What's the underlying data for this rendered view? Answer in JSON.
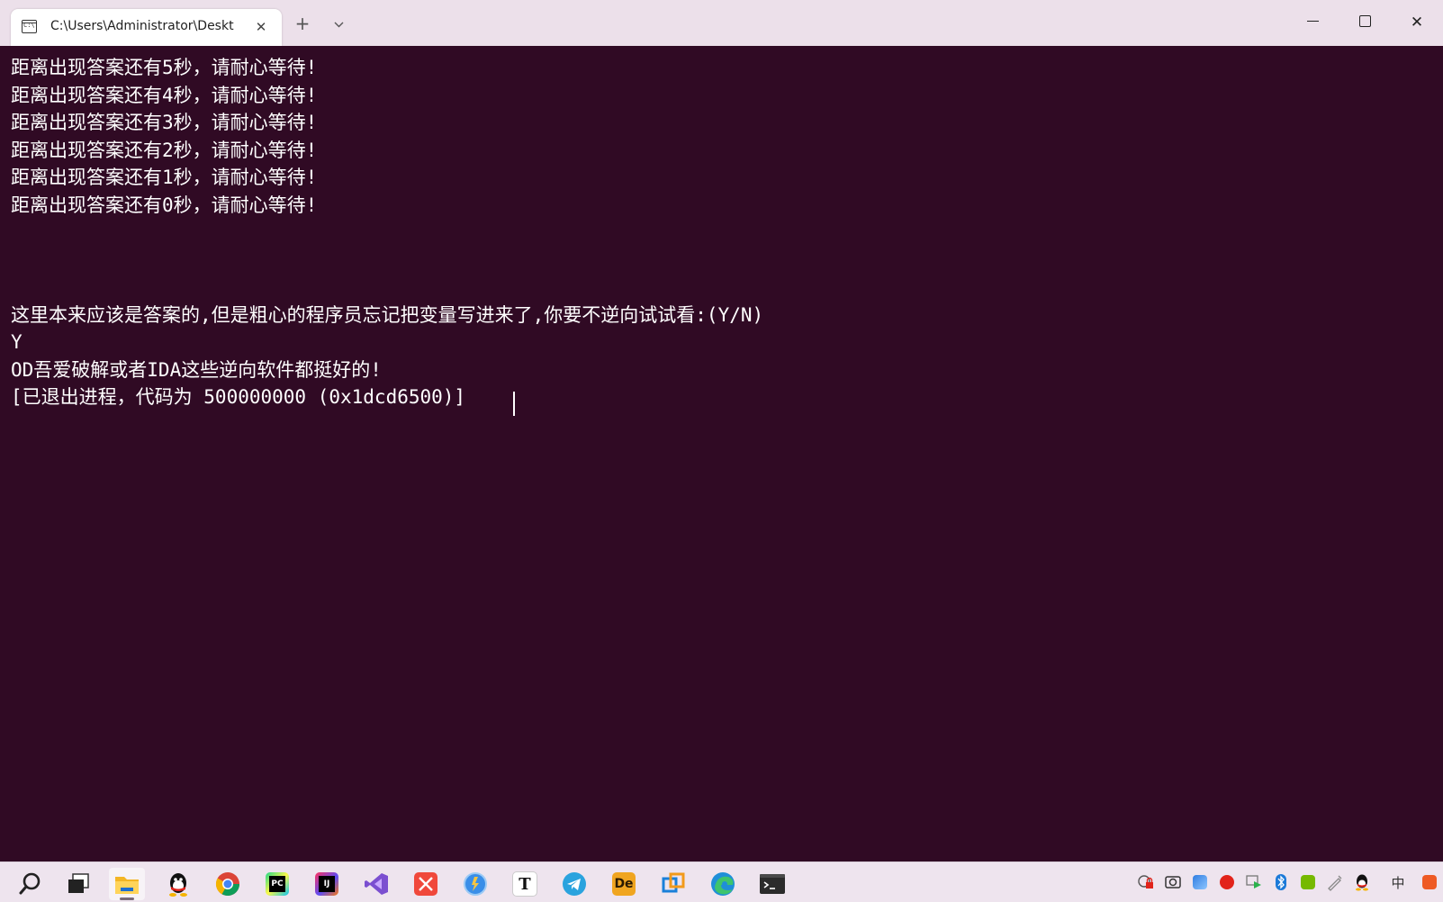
{
  "window": {
    "tab_title": "C:\\Users\\Administrator\\Deskt",
    "tab_icon_text": "C:\\",
    "tab_close": "✕",
    "new_tab": "+",
    "tab_dropdown": "⌄",
    "close_glyph": "✕"
  },
  "terminal": {
    "background": "#300a24",
    "foreground": "#ffffff",
    "lines": [
      "距离出现答案还有5秒，请耐心等待!",
      "距离出现答案还有4秒，请耐心等待!",
      "距离出现答案还有3秒，请耐心等待!",
      "距离出现答案还有2秒，请耐心等待!",
      "距离出现答案还有1秒，请耐心等待!",
      "距离出现答案还有0秒，请耐心等待!",
      "",
      "",
      "",
      "这里本来应该是答案的,但是粗心的程序员忘记把变量写进来了,你要不逆向试试看:(Y/N)",
      "Y",
      "OD吾爱破解或者IDA这些逆向软件都挺好的!",
      "[已退出进程，代码为 500000000 (0x1dcd6500)]"
    ]
  },
  "taskbar": {
    "apps": [
      {
        "icon": "search-icon",
        "label": ""
      },
      {
        "icon": "task-view-icon",
        "label": ""
      },
      {
        "icon": "file-explorer-icon",
        "label": ""
      },
      {
        "icon": "qq-icon",
        "label": ""
      },
      {
        "icon": "chrome-icon",
        "label": ""
      },
      {
        "icon": "pycharm-icon",
        "label": "PC"
      },
      {
        "icon": "intellij-icon",
        "label": "IJ"
      },
      {
        "icon": "visual-studio-icon",
        "label": ""
      },
      {
        "icon": "xmind-icon",
        "label": ""
      },
      {
        "icon": "app-blue-circle-icon",
        "label": ""
      },
      {
        "icon": "typora-icon",
        "label": "T"
      },
      {
        "icon": "telegram-icon",
        "label": ""
      },
      {
        "icon": "davinci-icon",
        "label": "De"
      },
      {
        "icon": "virtualbox-icon",
        "label": ""
      },
      {
        "icon": "edge-icon",
        "label": ""
      },
      {
        "icon": "terminal-icon",
        "label": ""
      }
    ],
    "tray": [
      {
        "icon": "security-lock-icon"
      },
      {
        "icon": "camera-icon"
      },
      {
        "icon": "image-app-icon"
      },
      {
        "icon": "audio-app-icon"
      },
      {
        "icon": "media-icon"
      },
      {
        "icon": "bluetooth-icon"
      },
      {
        "icon": "nvidia-icon"
      },
      {
        "icon": "pen-icon"
      },
      {
        "icon": "qq-tray-icon"
      },
      {
        "icon": "ime-icon",
        "label": "中"
      }
    ]
  }
}
